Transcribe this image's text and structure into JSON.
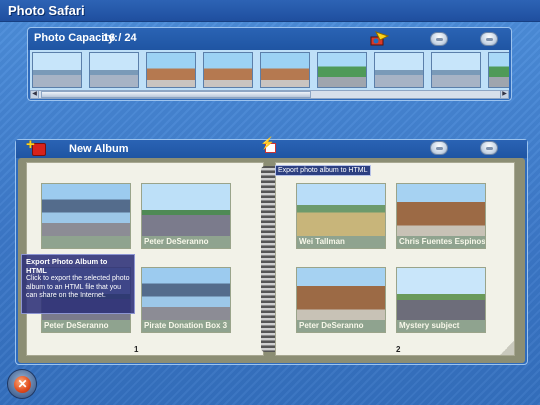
{
  "app": {
    "title": "Photo Safari",
    "watermark": ""
  },
  "capacity": {
    "label": "Photo Capacity:",
    "count": "16 / 24",
    "thumbnails": [
      "t-sky",
      "t-sky",
      "t-red",
      "t-red",
      "t-red",
      "t-green",
      "t-sky",
      "t-sky",
      "t-green"
    ]
  },
  "album": {
    "title": "New Album",
    "left_page": {
      "number": "1",
      "photos": [
        {
          "caption": "",
          "style": "p-fountain"
        },
        {
          "caption": "Peter DeSeranno",
          "style": "p-plaza"
        },
        {
          "caption": "Peter DeSeranno",
          "style": "p-plaza"
        },
        {
          "caption": "Pirate Donation Box 3",
          "style": "p-fountain"
        }
      ]
    },
    "right_page": {
      "number": "2",
      "photos": [
        {
          "caption": "Wei Tallman",
          "style": "p-person"
        },
        {
          "caption": "Chris Fuentes Espinosa",
          "style": "p-booth"
        },
        {
          "caption": "Peter DeSeranno",
          "style": "p-booth"
        },
        {
          "caption": "Mystery subject",
          "style": "p-mystery"
        }
      ]
    }
  },
  "tooltips": {
    "export_small": "Export photo album to HTML",
    "export_title": "Export Photo Album to HTML",
    "export_body": "Click to export the selected photo album to an HTML file that you can share on the Internet."
  },
  "icons": {
    "close": "close-icon",
    "new_album": "new-album-icon",
    "export": "export-icon",
    "camera": "camera-icon"
  }
}
